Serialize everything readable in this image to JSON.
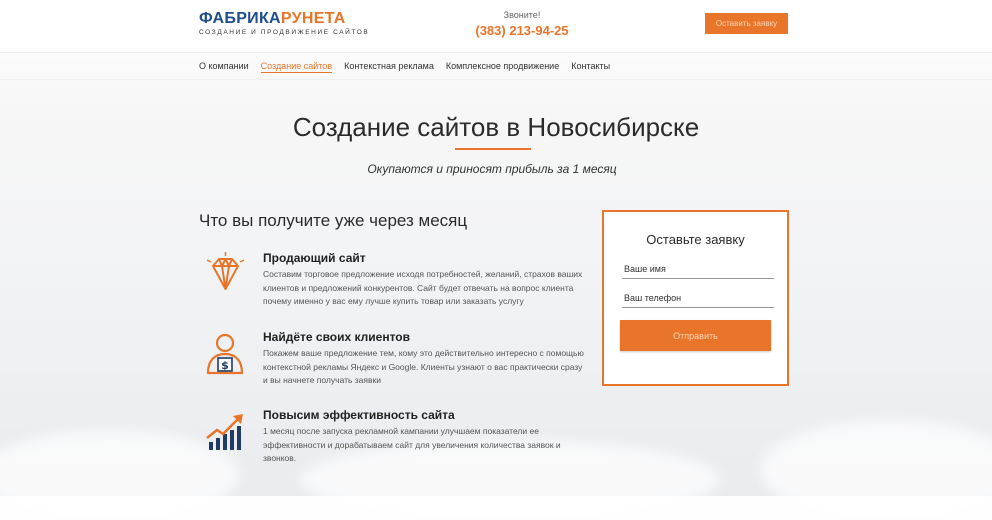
{
  "header": {
    "logo_part1": "ФАБРИКА",
    "logo_part2": "РУНЕТА",
    "logo_tagline": "создание и продвижение сайтов",
    "phone_label": "Звоните!",
    "phone_number": "(383) 213-94-25",
    "cta_label": "Оставить заявку"
  },
  "nav": [
    {
      "label": "О компании",
      "active": false
    },
    {
      "label": "Создание сайтов",
      "active": true
    },
    {
      "label": "Контекстная реклама",
      "active": false
    },
    {
      "label": "Комплексное продвижение",
      "active": false
    },
    {
      "label": "Контакты",
      "active": false
    }
  ],
  "hero": {
    "title": "Создание сайтов в Новосибирске",
    "subtitle": "Окупаются и приносят прибыль за 1 месяц"
  },
  "benefits": {
    "title": "Что вы получите уже через месяц",
    "items": [
      {
        "icon": "diamond-icon",
        "title": "Продающий сайт",
        "desc": "Составим торговое предложение исходя потребностей, желаний, страхов ваших клиентов и предложений конкурентов. Сайт будет отвечать на вопрос клиента почему именно у вас ему лучше купить товар или заказать услугу"
      },
      {
        "icon": "client-money-icon",
        "title": "Найдёте своих клиентов",
        "desc": "Покажем ваше предложение тем, кому это действительно интересно с помощью контекстной рекламы Яндекс и Google. Клиенты узнают о вас практически сразу и вы начнете получать заявки"
      },
      {
        "icon": "growth-chart-icon",
        "title": "Повысим эффективность сайта",
        "desc": "1 месяц после запуска рекламной кампании улучшаем показатели ее эффективности и дорабатываем сайт для увеличения количества заявок и звонков."
      }
    ]
  },
  "form": {
    "title": "Оставьте заявку",
    "name_placeholder": "Ваше имя",
    "phone_placeholder": "Ваш телефон",
    "submit_label": "Отправить"
  },
  "colors": {
    "accent": "#e8752a",
    "brand_blue": "#1f4e8c"
  }
}
